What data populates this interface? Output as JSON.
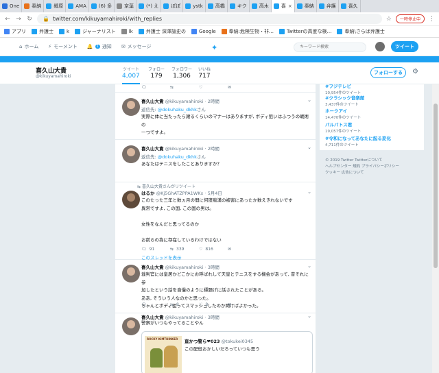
{
  "browser": {
    "tabs": [
      {
        "label": "One",
        "color": "#2a6fdb"
      },
      {
        "label": "奉納",
        "color": "#e8711a"
      },
      {
        "label": "郷原",
        "color": "#1da1f2"
      },
      {
        "label": "AMA",
        "color": "#1da1f2"
      },
      {
        "label": "(6) 多",
        "color": "#1da1f2"
      },
      {
        "label": "京葉",
        "color": "#888888"
      },
      {
        "label": "(*) え",
        "color": "#1da1f2"
      },
      {
        "label": "ぽぽ",
        "color": "#1da1f2"
      },
      {
        "label": "ystk",
        "color": "#1da1f2"
      },
      {
        "label": "高橋",
        "color": "#1da1f2"
      },
      {
        "label": "キク",
        "color": "#1da1f2"
      },
      {
        "label": "高木",
        "color": "#1da1f2"
      },
      {
        "label": "喜",
        "color": "#1da1f2",
        "active": true
      },
      {
        "label": "奉納",
        "color": "#1da1f2"
      },
      {
        "label": "弁護",
        "color": "#1da1f2"
      },
      {
        "label": "喜久",
        "color": "#1da1f2"
      }
    ],
    "url": "twitter.com/kikuyamahiroki/with_replies",
    "pause_label": "一時停止中",
    "bookmarks": [
      {
        "label": "アプリ",
        "color": "#4285f4"
      },
      {
        "label": "弁護士",
        "color": "#1da1f2"
      },
      {
        "label": "k",
        "color": "#1da1f2"
      },
      {
        "label": "ジャーナリスト",
        "color": "#1da1f2"
      },
      {
        "label": "lk",
        "color": "#888888"
      },
      {
        "label": "弁護士 深澤諭史の",
        "color": "#1da1f2"
      },
      {
        "label": "Google",
        "color": "#4285f4"
      },
      {
        "label": "奉納:危険生物・非…",
        "color": "#e8711a"
      },
      {
        "label": "Twitterの高度な検…",
        "color": "#1da1f2"
      },
      {
        "label": "奉納\\さらば弁護士",
        "color": "#1da1f2"
      }
    ]
  },
  "twitter_nav": {
    "home": "ホーム",
    "moments": "モーメント",
    "notifications": "通知",
    "notification_count": "1",
    "messages": "メッセージ",
    "search_placeholder": "キーワード検索",
    "tweet_button": "ツイート"
  },
  "profile": {
    "name": "喜久山大貴",
    "handle": "@kikuyamahiroki",
    "stats": [
      {
        "label": "ツイート",
        "value": "4,007"
      },
      {
        "label": "フォロー",
        "value": "179"
      },
      {
        "label": "フォロワー",
        "value": "1,306"
      },
      {
        "label": "いいね",
        "value": "717"
      }
    ],
    "follow_button": "フォローする"
  },
  "tweets": {
    "t1": {
      "name": "喜久山大貴",
      "handle": "@kikuyamahiroki",
      "time": "· 2時間",
      "reply_prefix": "返信先:",
      "reply_to": "@dokuhaku_dkhk",
      "reply_suffix": "さん",
      "lines": [
        "実際に体に当たったら謝るくらいのマナーはありますが, ボディ狙いはふつうの戦術の",
        "一つですよ。"
      ]
    },
    "t2": {
      "name": "喜久山大貴",
      "handle": "@kikuyamahiroki",
      "time": "· 2時間",
      "reply_prefix": "返信先:",
      "reply_to": "@dokuhaku_dkhk",
      "reply_suffix": "さん",
      "lines": [
        "あなたはテニスをしたことありますか？"
      ]
    },
    "t3": {
      "retweet_label": "喜久山大貴さんがリツイート",
      "name": "はるか",
      "handle": "@Kj5GhATZPPA1WKx",
      "time": "· 5月4日",
      "lines": [
        "このたった三年と数ヵ月の間に何度痴漢の被害にあったか数えきれないです",
        "異常ですよ, この国, この国の男は。",
        "",
        "女性をなんだと思ってるのか",
        "",
        "お前らの為に存在しているわけではない"
      ],
      "replies": "91",
      "retweets": "339",
      "likes": "816",
      "thread_link": "このスレッドを表示"
    },
    "t4": {
      "name": "喜久山大貴",
      "handle": "@kikuyamahiroki",
      "time": "· 3時間",
      "lines": [
        "裁判官には皇居かどこかにお呼ばれして天皇とテニスをする機会があって, 昔それに参",
        "加したという話を自慢のように標題げに話されたことがある。",
        "ああ, そういう人なのかと思った。",
        "ちゃんとボディ狙ってスマッシュしたのか聞けばよかった。"
      ],
      "retweets": "8",
      "likes": "8"
    },
    "t5": {
      "name": "喜久山大貴",
      "handle": "@kikuyamahiroki",
      "time": "· 3時間",
      "lines": [
        "警察がいつもやってることやん"
      ],
      "card": {
        "image_title": "ROCKY KIMTHINKER",
        "name": "直かつ警ら❤023",
        "handle": "@tokukei0345",
        "text": "この配役おかしいだろっていつも思う"
      }
    }
  },
  "sidebar": {
    "trends": [
      {
        "tag": "#フジテレビ",
        "count": "10,954件のツイート"
      },
      {
        "tag": "#クラシック音楽館",
        "count": "3,437件のツイート"
      },
      {
        "tag": "ホークアイ",
        "count": "14,470件のツイート"
      },
      {
        "tag": "バルバトス君",
        "count": "19,057件のツイート"
      },
      {
        "tag": "#令和になってあなたに起る変化",
        "count": "4,711件のツイート"
      }
    ],
    "footer": [
      "© 2019 Twitter  Twitterについて",
      "ヘルプセンター  規約  プライバシーポリシー",
      "クッキー  広告について"
    ]
  }
}
